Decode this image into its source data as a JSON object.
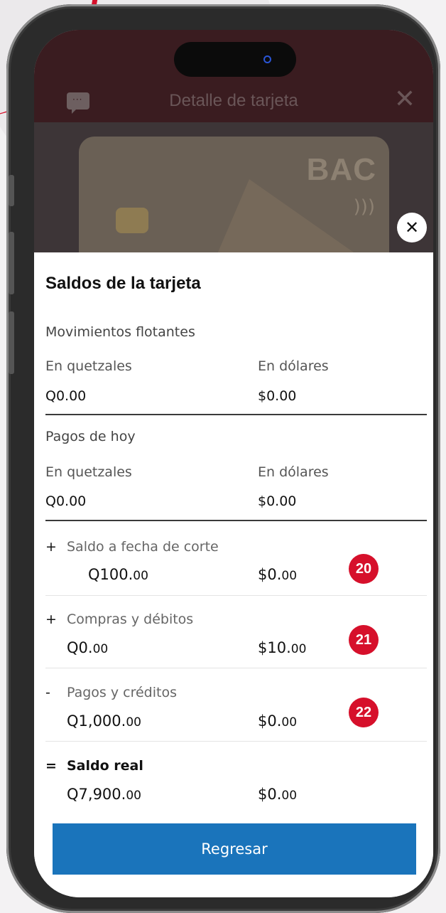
{
  "header": {
    "title": "Detalle de tarjeta"
  },
  "card": {
    "brand": "BAC"
  },
  "sheet": {
    "title": "Saldos de la tarjeta",
    "floating": {
      "label": "Movimientos flotantes",
      "col_q": "En quetzales",
      "col_d": "En dólares",
      "val_q": "Q0.00",
      "val_d": "$0.00"
    },
    "payments_today": {
      "label": "Pagos de hoy",
      "col_q": "En quetzales",
      "col_d": "En dólares",
      "val_q": "Q0.00",
      "val_d": "$0.00"
    },
    "rows": [
      {
        "op": "+",
        "label": "Saldo a fecha de corte",
        "q_int": "Q100.",
        "q_dec": "00",
        "d_int": "$0.",
        "d_dec": "00",
        "badge": "20"
      },
      {
        "op": "+",
        "label": "Compras y débitos",
        "q_int": "Q0.",
        "q_dec": "00",
        "d_int": "$10.",
        "d_dec": "00",
        "badge": "21"
      },
      {
        "op": "-",
        "label": "Pagos y créditos",
        "q_int": "Q1,000.",
        "q_dec": "00",
        "d_int": "$0.",
        "d_dec": "00",
        "badge": "22"
      }
    ],
    "total": {
      "op": "=",
      "label": "Saldo real",
      "q_int": "Q7,900.",
      "q_dec": "00",
      "d_int": "$0.",
      "d_dec": "00"
    },
    "back_label": "Regresar"
  },
  "colors": {
    "accent": "#1a74bb",
    "badge": "#d6102b"
  }
}
